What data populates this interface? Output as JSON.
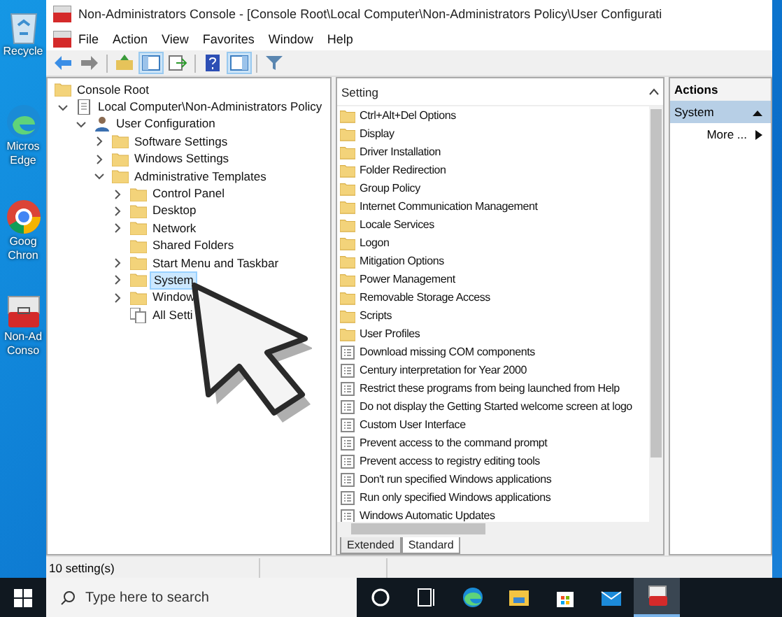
{
  "desktop_icons": [
    {
      "kind": "recycle",
      "label": "Recycle"
    },
    {
      "kind": "edge",
      "label": "Micros\nEdge"
    },
    {
      "kind": "chrome",
      "label": "Goog\nChron"
    },
    {
      "kind": "toolbox",
      "label": "Non-Ad\nConso"
    }
  ],
  "window": {
    "title": "Non-Administrators Console - [Console Root\\Local Computer\\Non-Administrators Policy\\User Configurati"
  },
  "menu": [
    "File",
    "Action",
    "View",
    "Favorites",
    "Window",
    "Help"
  ],
  "toolbar": [
    {
      "kind": "back",
      "pressed": false
    },
    {
      "kind": "forward",
      "pressed": false
    },
    {
      "kind": "up",
      "pressed": false
    },
    {
      "kind": "tree",
      "pressed": true
    },
    {
      "kind": "export",
      "pressed": false
    },
    {
      "kind": "help",
      "pressed": false
    },
    {
      "kind": "pane",
      "pressed": true
    },
    {
      "kind": "filter",
      "pressed": false
    }
  ],
  "tree": [
    {
      "label": "Console Root",
      "kind": "folder",
      "selected": false,
      "children": [
        {
          "label": "Local Computer\\Non-Administrators Policy",
          "kind": "policy",
          "expanded": true,
          "selected": false,
          "children": [
            {
              "label": "User Configuration",
              "kind": "user",
              "expanded": true,
              "selected": false,
              "children": [
                {
                  "label": "Software Settings",
                  "kind": "folder",
                  "expanded": false,
                  "selected": false
                },
                {
                  "label": "Windows Settings",
                  "kind": "folder",
                  "expanded": false,
                  "selected": false
                },
                {
                  "label": "Administrative Templates",
                  "kind": "folder",
                  "expanded": true,
                  "selected": false,
                  "children": [
                    {
                      "label": "Control Panel",
                      "kind": "folder",
                      "expanded": false,
                      "selected": false
                    },
                    {
                      "label": "Desktop",
                      "kind": "folder",
                      "expanded": false,
                      "selected": false
                    },
                    {
                      "label": "Network",
                      "kind": "folder",
                      "expanded": false,
                      "selected": false
                    },
                    {
                      "label": "Shared Folders",
                      "kind": "folder",
                      "selected": false
                    },
                    {
                      "label": "Start Menu and Taskbar",
                      "kind": "folder",
                      "expanded": false,
                      "selected": false
                    },
                    {
                      "label": "System",
                      "kind": "folder",
                      "expanded": false,
                      "selected": true
                    },
                    {
                      "label": "Window",
                      "kind": "folder",
                      "expanded": false,
                      "selected": false
                    },
                    {
                      "label": "All Setti",
                      "kind": "settings",
                      "selected": false
                    }
                  ]
                }
              ]
            }
          ]
        }
      ]
    }
  ],
  "list": {
    "column": "Setting",
    "items": [
      {
        "label": "Ctrl+Alt+Del Options",
        "kind": "folder"
      },
      {
        "label": "Display",
        "kind": "folder"
      },
      {
        "label": "Driver Installation",
        "kind": "folder"
      },
      {
        "label": "Folder Redirection",
        "kind": "folder"
      },
      {
        "label": "Group Policy",
        "kind": "folder"
      },
      {
        "label": "Internet Communication Management",
        "kind": "folder"
      },
      {
        "label": "Locale Services",
        "kind": "folder"
      },
      {
        "label": "Logon",
        "kind": "folder"
      },
      {
        "label": "Mitigation Options",
        "kind": "folder"
      },
      {
        "label": "Power Management",
        "kind": "folder"
      },
      {
        "label": "Removable Storage Access",
        "kind": "folder"
      },
      {
        "label": "Scripts",
        "kind": "folder"
      },
      {
        "label": "User Profiles",
        "kind": "folder"
      },
      {
        "label": "Download missing COM components",
        "kind": "setting"
      },
      {
        "label": "Century interpretation for Year 2000",
        "kind": "setting"
      },
      {
        "label": "Restrict these programs from being launched from Help",
        "kind": "setting"
      },
      {
        "label": "Do not display the Getting Started welcome screen at logo",
        "kind": "setting"
      },
      {
        "label": "Custom User Interface",
        "kind": "setting"
      },
      {
        "label": "Prevent access to the command prompt",
        "kind": "setting"
      },
      {
        "label": "Prevent access to registry editing tools",
        "kind": "setting"
      },
      {
        "label": "Don't run specified Windows applications",
        "kind": "setting"
      },
      {
        "label": "Run only specified Windows applications",
        "kind": "setting"
      },
      {
        "label": "Windows Automatic Updates",
        "kind": "setting"
      }
    ]
  },
  "tabs": [
    {
      "label": "Extended",
      "selected": false
    },
    {
      "label": "Standard",
      "selected": true
    }
  ],
  "actions": {
    "header": "Actions",
    "section": "System",
    "items": [
      "More ..."
    ]
  },
  "status_bar": "10 setting(s)",
  "taskbar": {
    "search": {
      "placeholder": "Type here to search"
    },
    "apps": [
      {
        "kind": "cortana",
        "active": false
      },
      {
        "kind": "taskview",
        "active": false
      },
      {
        "kind": "edge",
        "active": false
      },
      {
        "kind": "explorer",
        "active": false
      },
      {
        "kind": "store",
        "active": false
      },
      {
        "kind": "mail",
        "active": false
      },
      {
        "kind": "console",
        "active": true
      }
    ]
  }
}
